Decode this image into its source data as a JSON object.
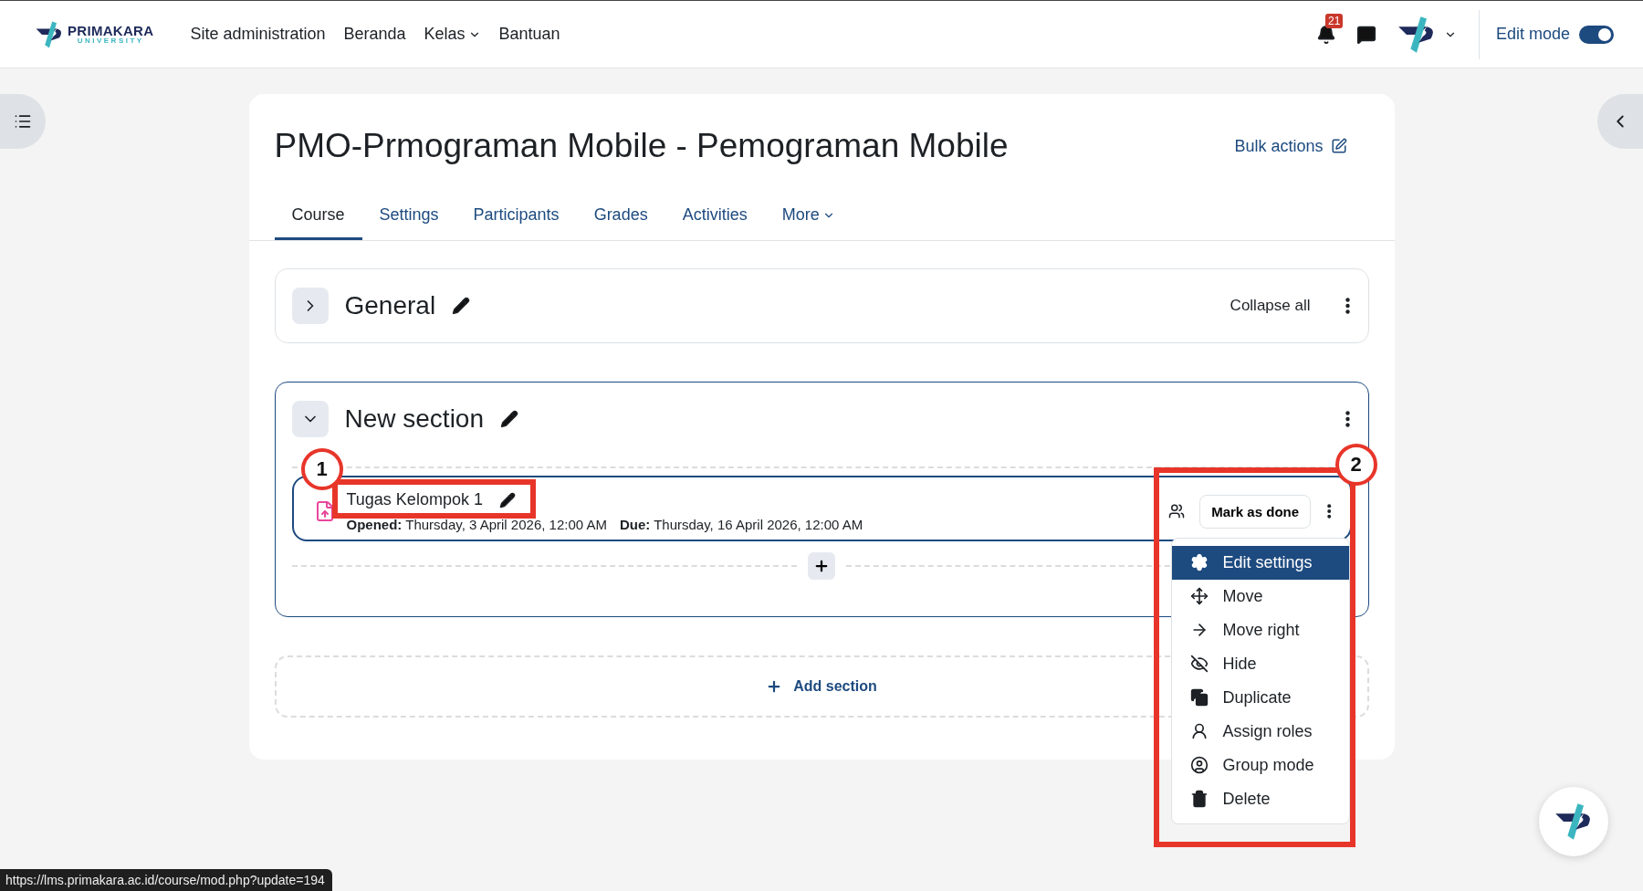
{
  "navbar": {
    "brand": "PRIMAKARA",
    "brand_sub": "UNIVERSITY",
    "links": [
      {
        "label": "Site administration",
        "has_menu": false
      },
      {
        "label": "Beranda",
        "has_menu": false
      },
      {
        "label": "Kelas",
        "has_menu": true
      },
      {
        "label": "Bantuan",
        "has_menu": false
      }
    ],
    "notification_count": "21",
    "edit_mode": {
      "label": "Edit mode",
      "on": true
    }
  },
  "course": {
    "title": "PMO-Prmograman Mobile - Pemograman Mobile",
    "bulk_actions": "Bulk actions",
    "tabs": [
      {
        "label": "Course",
        "selected": true,
        "has_menu": false
      },
      {
        "label": "Settings",
        "selected": false,
        "has_menu": false
      },
      {
        "label": "Participants",
        "selected": false,
        "has_menu": false
      },
      {
        "label": "Grades",
        "selected": false,
        "has_menu": false
      },
      {
        "label": "Activities",
        "selected": false,
        "has_menu": false
      },
      {
        "label": "More",
        "selected": false,
        "has_menu": true
      }
    ],
    "collapse_all": "Collapse all",
    "sections": [
      {
        "title": "General",
        "expanded": false
      },
      {
        "title": "New section",
        "expanded": true,
        "activities": [
          {
            "name": "Tugas Kelompok 1",
            "opened_label": "Opened:",
            "opened": "Thursday, 3 April 2026, 12:00 AM",
            "due_label": "Due:",
            "due": "Thursday, 16 April 2026, 12:00 AM",
            "mark_button": "Mark as done",
            "menu": [
              {
                "label": "Edit settings",
                "kind": "settings",
                "selected": true
              },
              {
                "label": "Move",
                "kind": "move",
                "selected": false
              },
              {
                "label": "Move right",
                "kind": "indent",
                "selected": false
              },
              {
                "label": "Hide",
                "kind": "hide",
                "selected": false
              },
              {
                "label": "Duplicate",
                "kind": "duplicate",
                "selected": false
              },
              {
                "label": "Assign roles",
                "kind": "roles",
                "selected": false
              },
              {
                "label": "Group mode",
                "kind": "groupmode",
                "selected": false
              },
              {
                "label": "Delete",
                "kind": "delete",
                "selected": false
              }
            ]
          }
        ]
      }
    ],
    "add_section": "Add section"
  },
  "annotations": [
    {
      "number": "1"
    },
    {
      "number": "2"
    }
  ],
  "status_url": "https://lms.primakara.ac.id/course/mod.php?update=194"
}
